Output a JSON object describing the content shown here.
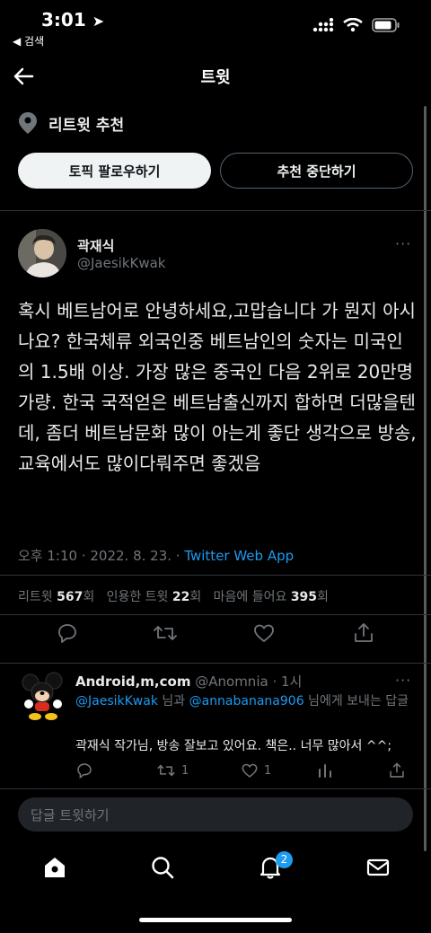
{
  "status": {
    "time": "3:01",
    "back_app": "◀ 검색"
  },
  "header": {
    "title": "트윗"
  },
  "recommendation": {
    "label": "리트윗 추천",
    "follow_topic": "토픽 팔로우하기",
    "stop_recommend": "추천 중단하기"
  },
  "tweet": {
    "author_name": "곽재식",
    "author_handle": "@JaesikKwak",
    "more": "···",
    "text": "혹시 베트남어로 안녕하세요,고맙습니다 가 뭔지 아시나요? 한국체류 외국인중 베트남인의 숫자는 미국인의 1.5배 이상. 가장 많은 중국인 다음 2위로 20만명 가량. 한국 국적얻은 베트남출신까지 합하면 더많을텐데, 좀더 베트남문화 많이 아는게 좋단 생각으로 방송,교육에서도 많이다뤄주면 좋겠음",
    "time": "오후 1:10 · 2022. 8. 23. · ",
    "source": "Twitter Web App",
    "stats": {
      "retweets_label": "리트윗 ",
      "retweets": "567",
      "retweets_unit": "회",
      "quotes_label": "인용한 트윗 ",
      "quotes": "22",
      "quotes_unit": "회",
      "likes_label": "마음에 들어요 ",
      "likes": "395",
      "likes_unit": "회"
    }
  },
  "reply": {
    "name": "Android,m,com",
    "handle": "@Anomnia",
    "time": "· 1시",
    "more": "···",
    "to_user1": "@JaesikKwak",
    "to_mid": " 님과 ",
    "to_user2": "@annabanana906",
    "to_end": " 님에게 보내는 답글",
    "text": "곽재식 작가님, 방송 잘보고 있어요. 책은.. 너무 많아서 ^^;",
    "retweet_count": "1",
    "like_count": "1"
  },
  "compose": {
    "placeholder": "답글 트윗하기"
  },
  "nav": {
    "notification_badge": "2"
  },
  "colors": {
    "accent": "#1d9bf0",
    "background": "#000000",
    "muted": "#71767b"
  }
}
